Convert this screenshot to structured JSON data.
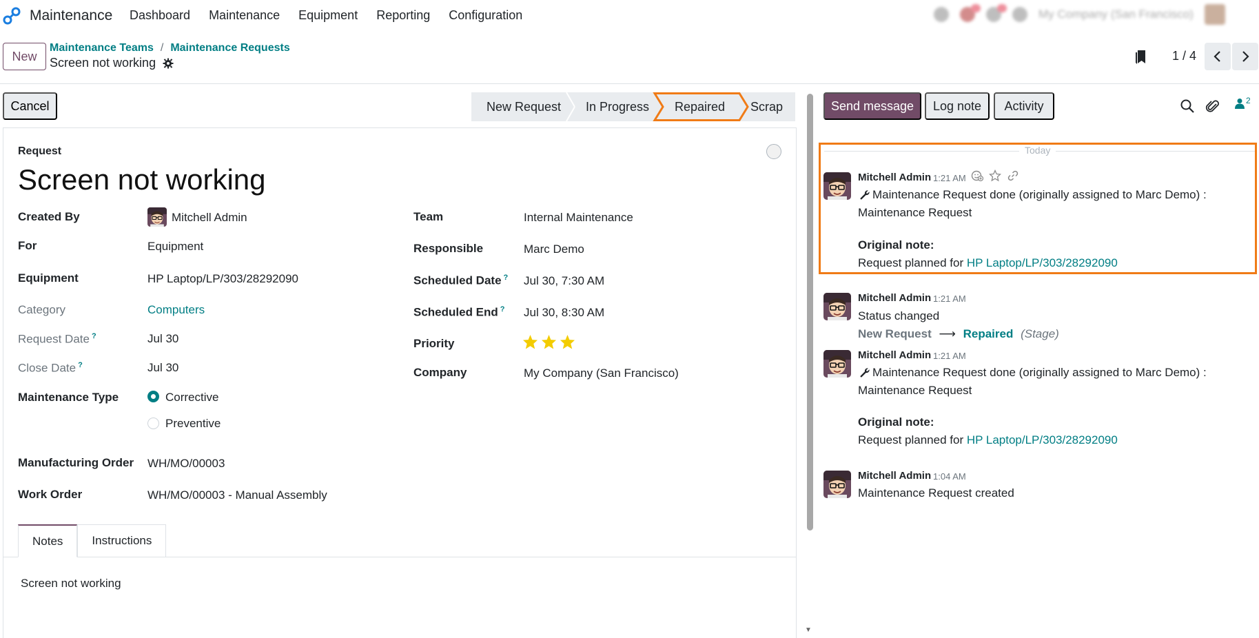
{
  "app": {
    "name": "Maintenance"
  },
  "menu": [
    "Dashboard",
    "Maintenance",
    "Equipment",
    "Reporting",
    "Configuration"
  ],
  "systray": {
    "company": "My Company (San Francisco)"
  },
  "control": {
    "new_label": "New",
    "breadcrumb": [
      "Maintenance Teams",
      "Maintenance Requests"
    ],
    "record_title": "Screen not working",
    "pager_value": "1 / 4"
  },
  "statusbar": {
    "cancel_label": "Cancel",
    "stages": [
      "New Request",
      "In Progress",
      "Repaired",
      "Scrap"
    ],
    "active_stage": "Repaired"
  },
  "form": {
    "request_label": "Request",
    "title": "Screen not working",
    "left": {
      "created_by": {
        "label": "Created By",
        "value": "Mitchell Admin"
      },
      "for": {
        "label": "For",
        "value": "Equipment"
      },
      "equipment": {
        "label": "Equipment",
        "value": "HP Laptop/LP/303/28292090"
      },
      "category": {
        "label": "Category",
        "value": "Computers"
      },
      "request_date": {
        "label": "Request Date",
        "value": "Jul 30"
      },
      "close_date": {
        "label": "Close Date",
        "value": "Jul 30"
      },
      "maintenance_type": {
        "label": "Maintenance Type",
        "options": [
          "Corrective",
          "Preventive"
        ],
        "selected": "Corrective"
      },
      "manufacturing_order": {
        "label": "Manufacturing Order",
        "value": "WH/MO/00003"
      },
      "work_order": {
        "label": "Work Order",
        "value": "WH/MO/00003 - Manual Assembly"
      }
    },
    "right": {
      "team": {
        "label": "Team",
        "value": "Internal Maintenance"
      },
      "responsible": {
        "label": "Responsible",
        "value": "Marc Demo"
      },
      "scheduled_date": {
        "label": "Scheduled Date",
        "value": "Jul 30, 7:30 AM"
      },
      "scheduled_end": {
        "label": "Scheduled End",
        "value": "Jul 30, 8:30 AM"
      },
      "priority": {
        "label": "Priority",
        "stars": 3,
        "max": 3
      },
      "company": {
        "label": "Company",
        "value": "My Company (San Francisco)"
      }
    },
    "help_mark": "?",
    "tabs": [
      "Notes",
      "Instructions"
    ],
    "notes": "Screen not working"
  },
  "chatter": {
    "send_message": "Send message",
    "log_note": "Log note",
    "activity": "Activity",
    "followers_count": "2",
    "today": "Today",
    "messages": [
      {
        "author": "Mitchell Admin",
        "time": "1:21 AM",
        "line1": "Maintenance Request done (originally assigned to Marc Demo) :",
        "line2": "Maintenance Request",
        "note_title": "Original note:",
        "note_prefix": "Request planned for ",
        "note_link": "HP Laptop/LP/303/28292090"
      },
      {
        "author": "Mitchell Admin",
        "time": "1:21 AM",
        "line1": "Status changed",
        "stage_old": "New Request",
        "stage_new": "Repaired",
        "stage_field": "(Stage)"
      },
      {
        "author": "Mitchell Admin",
        "time": "1:21 AM",
        "line1": "Maintenance Request done (originally assigned to Marc Demo) :",
        "line2": "Maintenance Request",
        "note_title": "Original note:",
        "note_prefix": "Request planned for ",
        "note_link": "HP Laptop/LP/303/28292090"
      },
      {
        "author": "Mitchell Admin",
        "time": "1:04 AM",
        "line1": "Maintenance Request created"
      }
    ]
  },
  "colors": {
    "brand": "#714b67",
    "link": "#017e84",
    "highlight": "#f07b16",
    "star": "#f3cc00"
  }
}
